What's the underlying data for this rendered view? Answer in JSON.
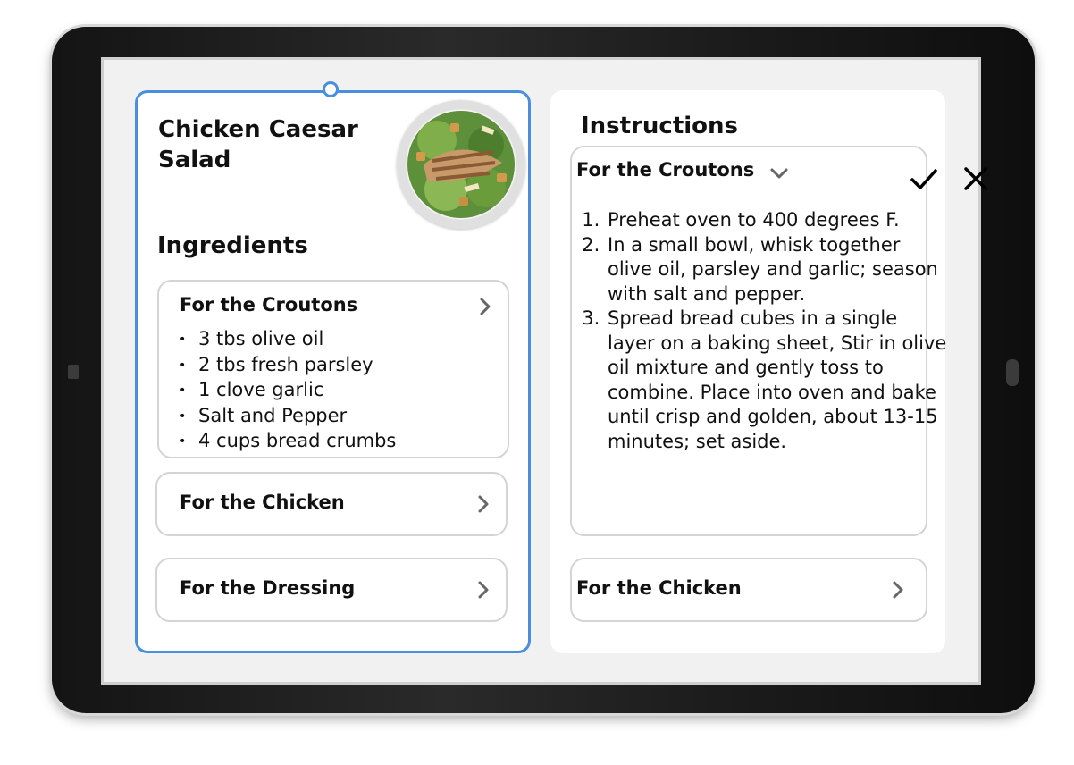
{
  "recipe": {
    "title": "Chicken Caesar Salad",
    "ingredients_heading": "Ingredients",
    "ingredient_groups": [
      {
        "label": "For the Croutons",
        "items": [
          "3 tbs olive oil",
          "2 tbs fresh parsley",
          "1 clove garlic",
          "Salt and Pepper",
          "4 cups bread crumbs"
        ]
      },
      {
        "label": "For the Chicken"
      },
      {
        "label": "For the Dressing"
      }
    ]
  },
  "instructions": {
    "heading": "Instructions",
    "sections": [
      {
        "label": "For the Croutons",
        "steps": [
          "Preheat oven to 400 degrees F.",
          "In a small bowl, whisk together olive oil, parsley and garlic; season with salt and pepper.",
          "Spread bread cubes in a single layer on a baking sheet, Stir in olive oil mixture and gently toss to combine. Place into oven and bake until crisp and golden, about 13-15 minutes; set aside."
        ]
      },
      {
        "label": "For the Chicken"
      }
    ]
  },
  "actions": {
    "confirm_icon": "checkmark-icon",
    "cancel_icon": "close-icon"
  },
  "colors": {
    "selection": "#4a8fde",
    "chevron": "#666666"
  }
}
